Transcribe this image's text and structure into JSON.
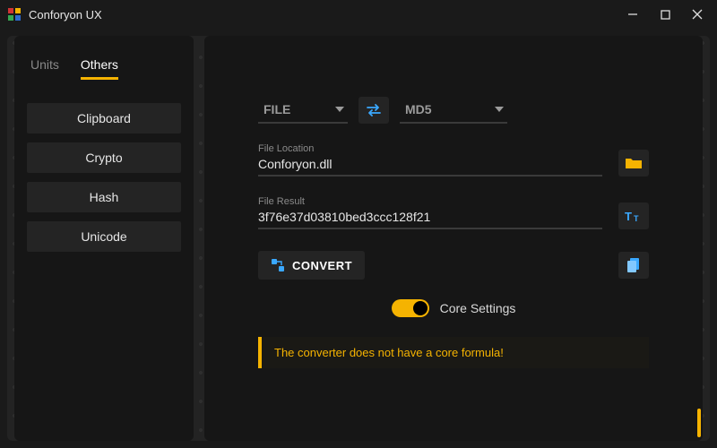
{
  "app": {
    "title": "Conforyon UX"
  },
  "window_controls": {
    "min": "minimize",
    "max": "maximize",
    "close": "close"
  },
  "sidebar": {
    "tabs": [
      {
        "label": "Units",
        "active": false
      },
      {
        "label": "Others",
        "active": true
      }
    ],
    "items": [
      {
        "label": "Clipboard"
      },
      {
        "label": "Crypto"
      },
      {
        "label": "Hash"
      },
      {
        "label": "Unicode"
      }
    ]
  },
  "main": {
    "source_dropdown": {
      "label": "FILE"
    },
    "target_dropdown": {
      "label": "MD5"
    },
    "file_location": {
      "label": "File Location",
      "value": "Conforyon.dll"
    },
    "file_result": {
      "label": "File Result",
      "value": "3f76e37d03810bed3ccc128f21"
    },
    "convert_label": "CONVERT",
    "toggle": {
      "label": "Core Settings",
      "state": true
    },
    "warning": "The converter does not have a core formula!"
  },
  "colors": {
    "accent": "#f5b301",
    "swap_icon": "#3aa8ff"
  }
}
